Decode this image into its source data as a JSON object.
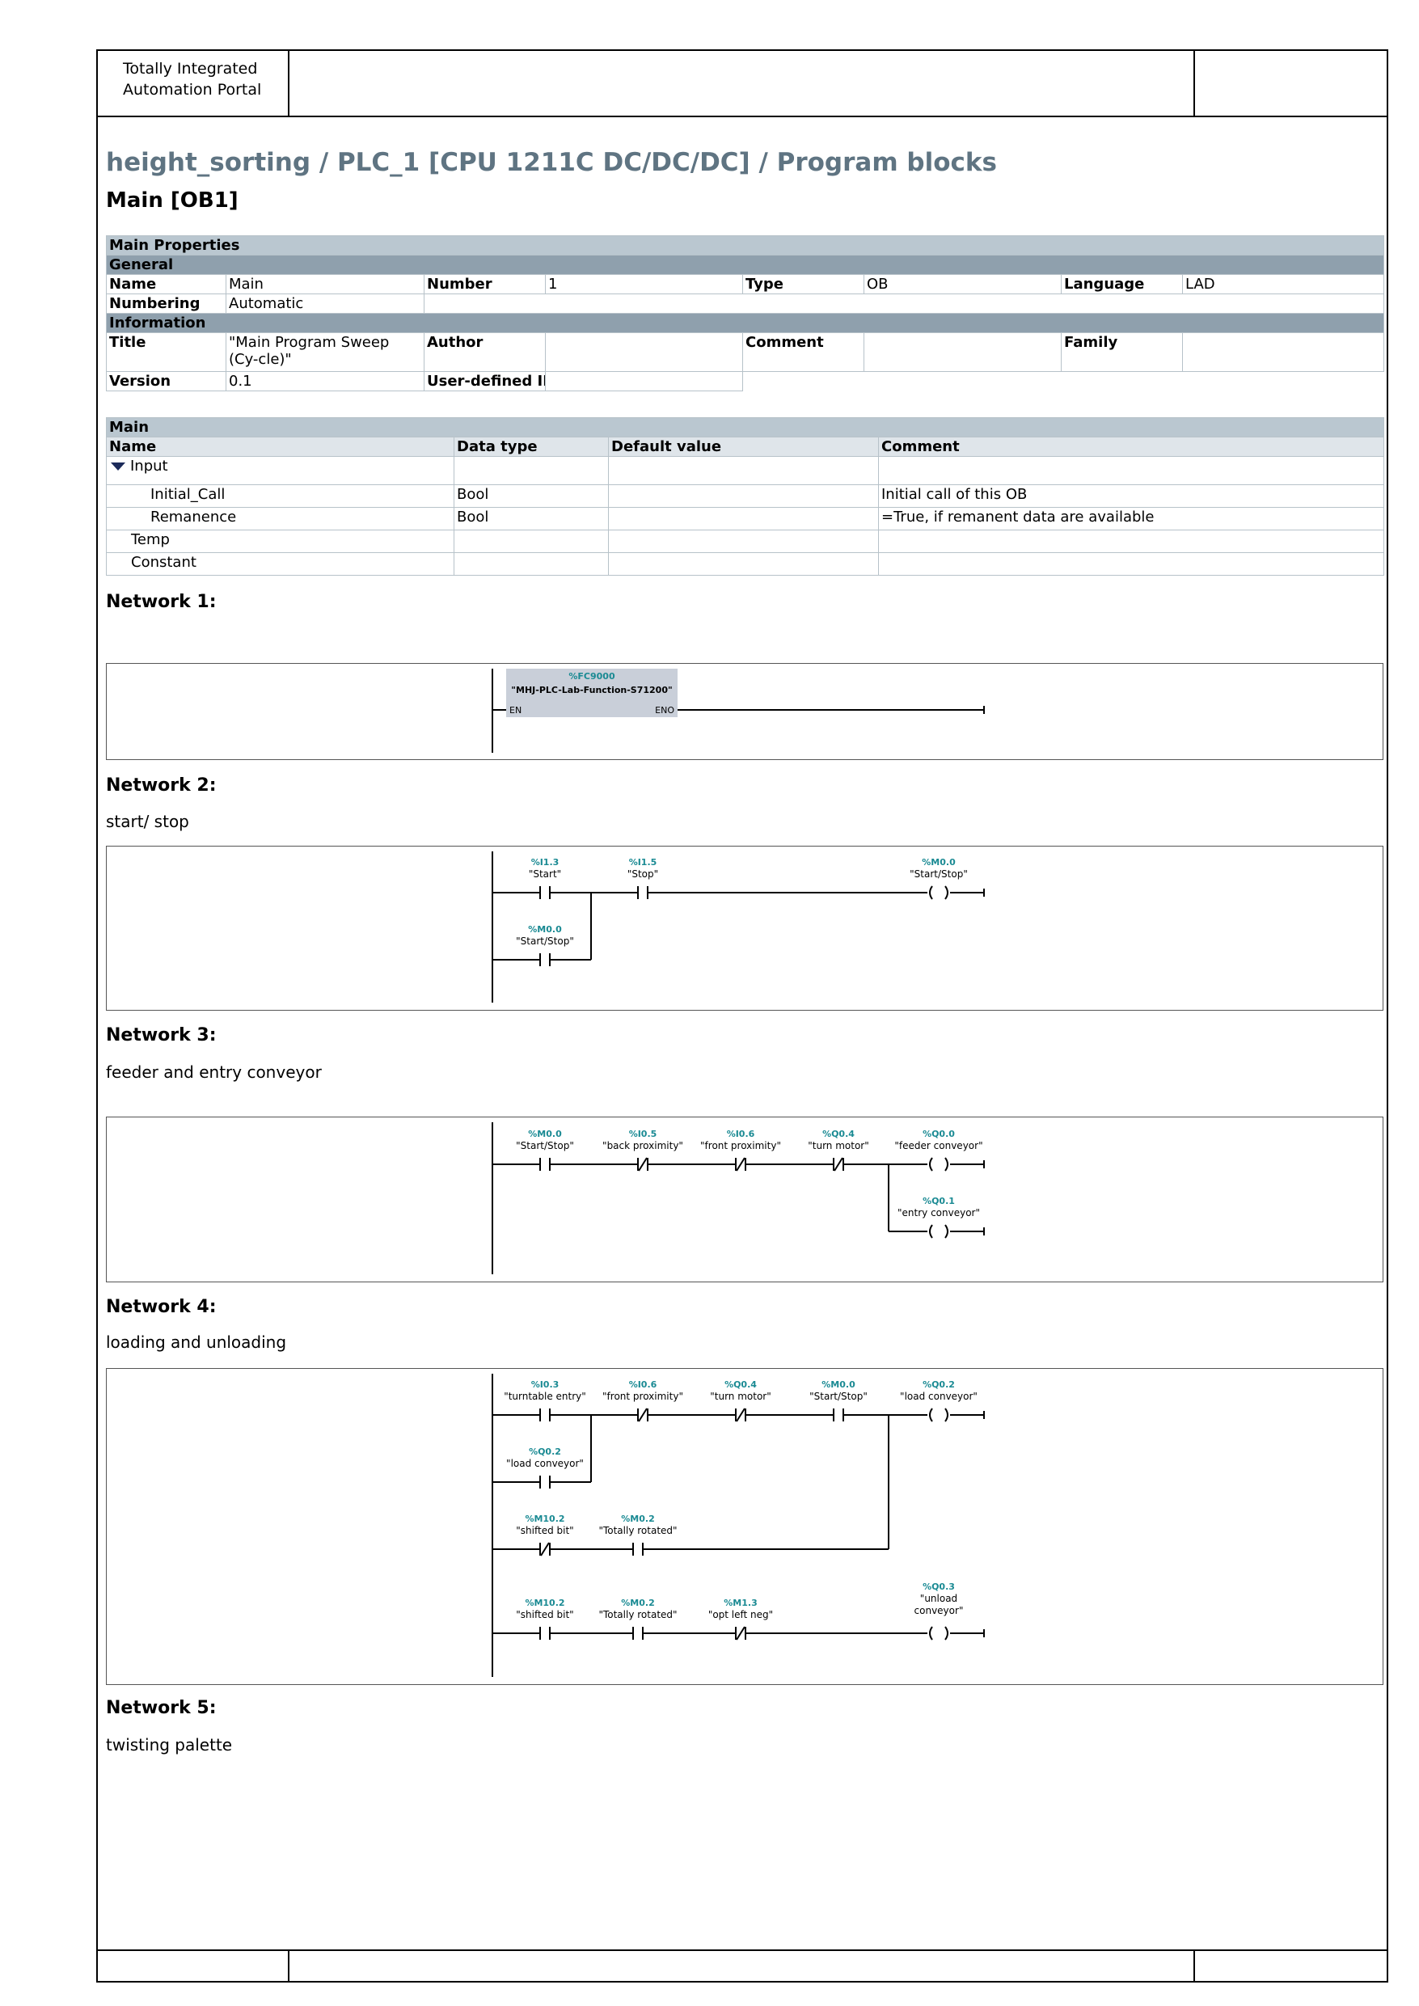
{
  "header": {
    "app_name_line1": "Totally Integrated",
    "app_name_line2": "Automation Portal"
  },
  "page": {
    "path_title": "height_sorting / PLC_1 [CPU 1211C DC/DC/DC] / Program blocks",
    "block_title": "Main [OB1]"
  },
  "properties": {
    "section": "Main Properties",
    "general": "General",
    "name_label": "Name",
    "name_value": "Main",
    "number_label": "Number",
    "number_value": "1",
    "type_label": "Type",
    "type_value": "OB",
    "language_label": "Language",
    "language_value": "LAD",
    "numbering_label": "Numbering",
    "numbering_value": "Automatic",
    "information": "Information",
    "title_label": "Title",
    "title_value": "\"Main Program Sweep (Cy-cle)\"",
    "author_label": "Author",
    "author_value": "",
    "comment_label": "Comment",
    "comment_value": "",
    "family_label": "Family",
    "family_value": "",
    "version_label": "Version",
    "version_value": "0.1",
    "userid_label": "User-defined ID",
    "userid_value": ""
  },
  "interface": {
    "section": "Main",
    "columns": [
      "Name",
      "Data type",
      "Default value",
      "Comment"
    ],
    "rows": [
      {
        "name": "Input",
        "type": "",
        "default": "",
        "comment": ""
      },
      {
        "name": "Initial_Call",
        "type": "Bool",
        "default": "",
        "comment": "Initial call of this OB"
      },
      {
        "name": "Remanence",
        "type": "Bool",
        "default": "",
        "comment": "=True, if remanent data are available"
      },
      {
        "name": "Temp",
        "type": "",
        "default": "",
        "comment": ""
      },
      {
        "name": "Constant",
        "type": "",
        "default": "",
        "comment": ""
      }
    ]
  },
  "networks": [
    {
      "title": "Network 1:",
      "comment": "",
      "fb": {
        "address": "%FC9000",
        "name": "\"MHJ-PLC-Lab-Function-S71200\"",
        "en": "EN",
        "eno": "ENO"
      }
    },
    {
      "title": "Network 2:",
      "comment": "start/ stop",
      "labels": [
        {
          "addr": "%I1.3",
          "sym": "\"Start\""
        },
        {
          "addr": "%I1.5",
          "sym": "\"Stop\""
        },
        {
          "addr": "%M0.0",
          "sym": "\"Start/Stop\""
        },
        {
          "addr": "%M0.0",
          "sym": "\"Start/Stop\""
        }
      ]
    },
    {
      "title": "Network 3:",
      "comment": "feeder and entry conveyor",
      "labels": [
        {
          "addr": "%M0.0",
          "sym": "\"Start/Stop\""
        },
        {
          "addr": "%I0.5",
          "sym": "\"back proximity\""
        },
        {
          "addr": "%I0.6",
          "sym": "\"front proximity\""
        },
        {
          "addr": "%Q0.4",
          "sym": "\"turn motor\""
        },
        {
          "addr": "%Q0.0",
          "sym": "\"feeder conveyor\""
        },
        {
          "addr": "%Q0.1",
          "sym": "\"entry conveyor\""
        }
      ]
    },
    {
      "title": "Network 4:",
      "comment": "loading and unloading",
      "labels": [
        {
          "addr": "%I0.3",
          "sym": "\"turntable entry\""
        },
        {
          "addr": "%I0.6",
          "sym": "\"front proximity\""
        },
        {
          "addr": "%Q0.4",
          "sym": "\"turn motor\""
        },
        {
          "addr": "%M0.0",
          "sym": "\"Start/Stop\""
        },
        {
          "addr": "%Q0.2",
          "sym": "\"load conveyor\""
        },
        {
          "addr": "%Q0.2",
          "sym": "\"load conveyor\""
        },
        {
          "addr": "%M10.2",
          "sym": "\"shifted bit\""
        },
        {
          "addr": "%M0.2",
          "sym": "\"Totally rotated\""
        },
        {
          "addr": "%M10.2",
          "sym": "\"shifted bit\""
        },
        {
          "addr": "%M0.2",
          "sym": "\"Totally rotated\""
        },
        {
          "addr": "%M1.3",
          "sym": "\"opt left neg\""
        },
        {
          "addr": "%Q0.3",
          "sym": "\"unload",
          "sym2": "conveyor\""
        }
      ]
    },
    {
      "title": "Network 5:",
      "comment": "twisting palette"
    }
  ]
}
